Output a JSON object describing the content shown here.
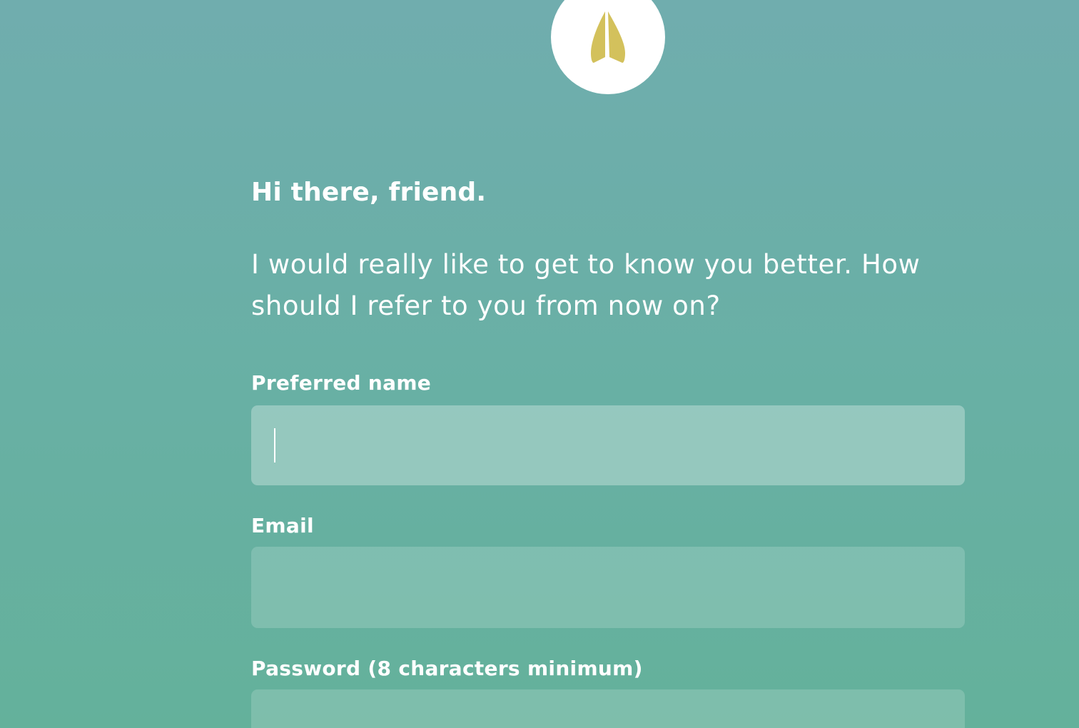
{
  "logo": {
    "icon": "folded-leaf-icon",
    "accent_color": "#d3c15c"
  },
  "greeting": "Hi there, friend.",
  "intro": "I would really like to get to know you better. How should I refer to you from now on?",
  "form": {
    "preferred_name": {
      "label": "Preferred name",
      "value": "",
      "focused": true
    },
    "email": {
      "label": "Email",
      "value": ""
    },
    "password": {
      "label": "Password (8 characters minimum)",
      "value": ""
    }
  }
}
